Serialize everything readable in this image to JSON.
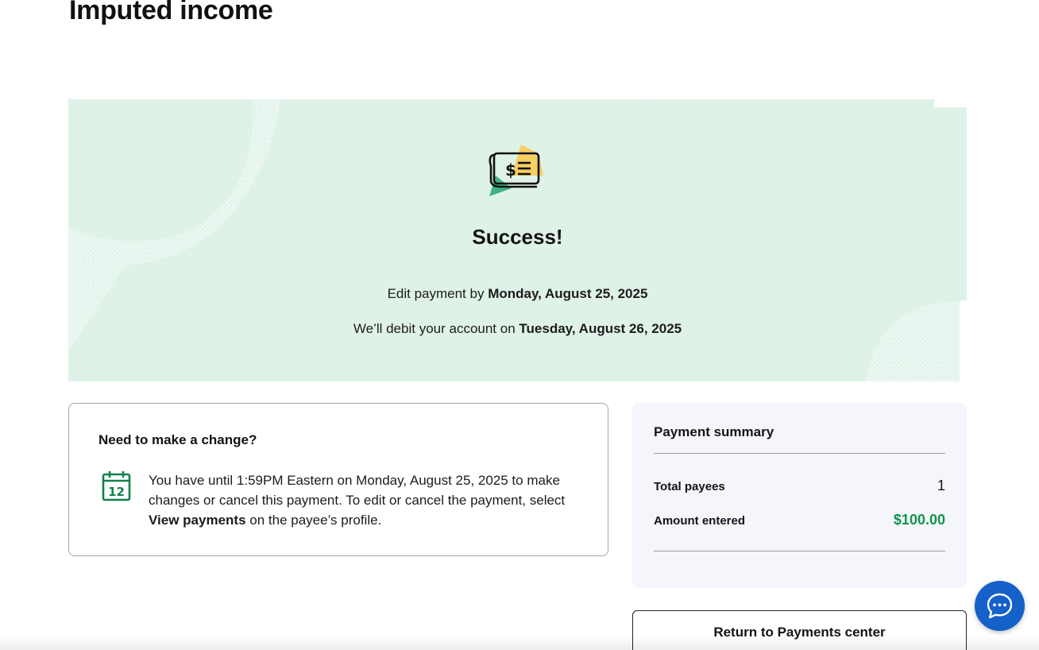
{
  "page": {
    "title": "Imputed income"
  },
  "success": {
    "icon": "check-money-icon",
    "title": "Success!",
    "edit_prefix": "Edit payment by",
    "edit_date": "Monday, August 25, 2025",
    "debit_prefix": "We’ll debit your account on",
    "debit_date": "Tuesday, August 26, 2025"
  },
  "change_card": {
    "title": "Need to make a change?",
    "calendar_day": "12",
    "text_before": "You have until 1:59PM Eastern on Monday, August 25, 2025 to make changes or cancel this payment. To edit or cancel the payment, select",
    "text_link": "View payments",
    "text_after": "on the payee’s profile."
  },
  "summary": {
    "title": "Payment summary",
    "total_payees_label": "Total payees",
    "total_payees_value": "1",
    "amount_label": "Amount entered",
    "amount_value": "$100.00"
  },
  "actions": {
    "return_label": "Return to Payments center"
  },
  "chat": {
    "icon": "chat-bubble-icon"
  },
  "colors": {
    "banner_bg": "#dff2e8",
    "accent_green": "#12934a",
    "chat_blue": "#1560c9",
    "summary_bg": "#f4f6fb"
  }
}
